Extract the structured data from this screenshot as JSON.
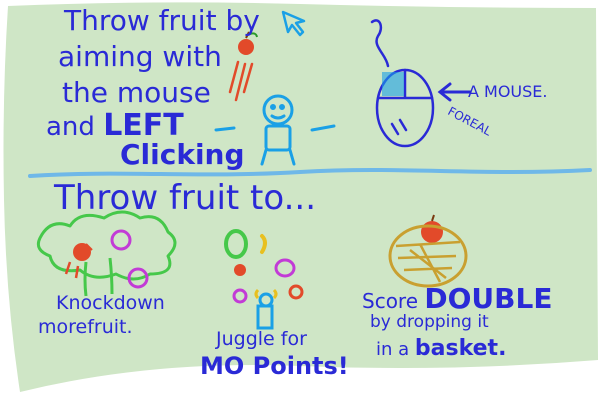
{
  "instructions": {
    "line1": "Throw fruit by",
    "line2": "aiming with",
    "line3": "the mouse",
    "line4_prefix": "and",
    "line4_emph": "LEFT",
    "line5": "Clicking"
  },
  "mouse_note": {
    "label": "A MOUSE.",
    "sub": "FOREAL"
  },
  "section_heading": "Throw fruit to...",
  "goals": [
    {
      "line1": "Knockdown",
      "line2": "morefruit."
    },
    {
      "line1": "Juggle for",
      "line2": "MO Points!"
    },
    {
      "line1_prefix": "Score",
      "line1_emph": "DOUBLE",
      "line2": "by dropping it",
      "line3_prefix": "in a",
      "line3_emph": "basket."
    }
  ],
  "colors": {
    "ink": "#2a2ad6",
    "background_wash": "#cfe6c6",
    "divider": "#6fb8e8",
    "stick_figure": "#1aa0e6",
    "apple": "#e24a2a",
    "plum": "#c23bd6",
    "tree": "#46c84a",
    "basket": "#c9a030"
  },
  "icons": [
    "cursor-arrow-icon",
    "mouse-icon",
    "apple-icon",
    "stick-figure-icon",
    "tree-icon",
    "plum-icon",
    "basket-icon"
  ]
}
